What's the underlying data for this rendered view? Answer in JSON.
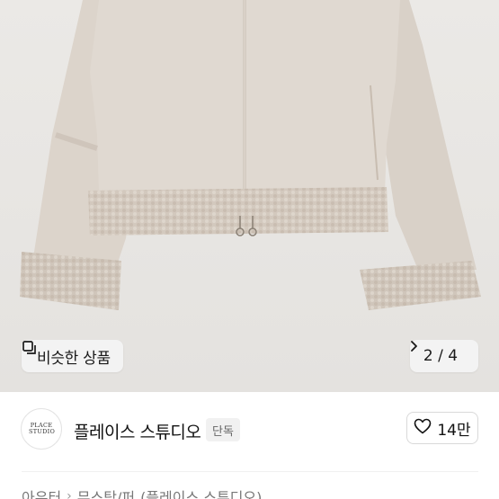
{
  "product_image": {
    "description_icon": "product-photo"
  },
  "similar_button": {
    "icon": "similar-items-icon",
    "label": "비슷한 상품"
  },
  "pager": {
    "text": "2 / 4",
    "icon": "chevron-right-icon"
  },
  "store": {
    "logo_text": "PLACE STUDIO",
    "name": "플레이스 스튜디오",
    "badge": "단독"
  },
  "like": {
    "icon": "heart-icon",
    "count": "14만"
  },
  "breadcrumb": {
    "items": [
      "아우터",
      "무스탕/퍼",
      "(플레이스 스튜디오)"
    ]
  },
  "colors": {
    "background_photo": "#e8e6e3",
    "jacket": "#ddd5cc",
    "shearling": "#d6cdc3",
    "button_bg": "#f3f3f3"
  }
}
